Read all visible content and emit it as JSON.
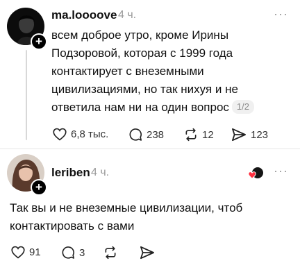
{
  "post": {
    "username": "ma.loooove",
    "time": "4 ч.",
    "more_icon": "more-dots-icon",
    "text": "всем доброе утро, кроме Ирины Подзоровой, которая с 1999 года контактирует с внеземными цивилизациями, но так нихуя и не ответила нам ни на один вопрос",
    "page_indicator": "1/2",
    "actions": {
      "likes": "6,8 тыс.",
      "comments": "238",
      "reposts": "12",
      "shares": "123"
    }
  },
  "reply": {
    "username": "leriben",
    "time": "4 ч.",
    "more_icon": "more-dots-icon",
    "text": "Так вы и не внеземные цивилизации, чтоб контактировать с вами",
    "actions": {
      "likes": "91",
      "comments": "3"
    }
  },
  "colors": {
    "text": "#101010",
    "muted": "#999999",
    "heart_reaction": "#ff3040"
  }
}
